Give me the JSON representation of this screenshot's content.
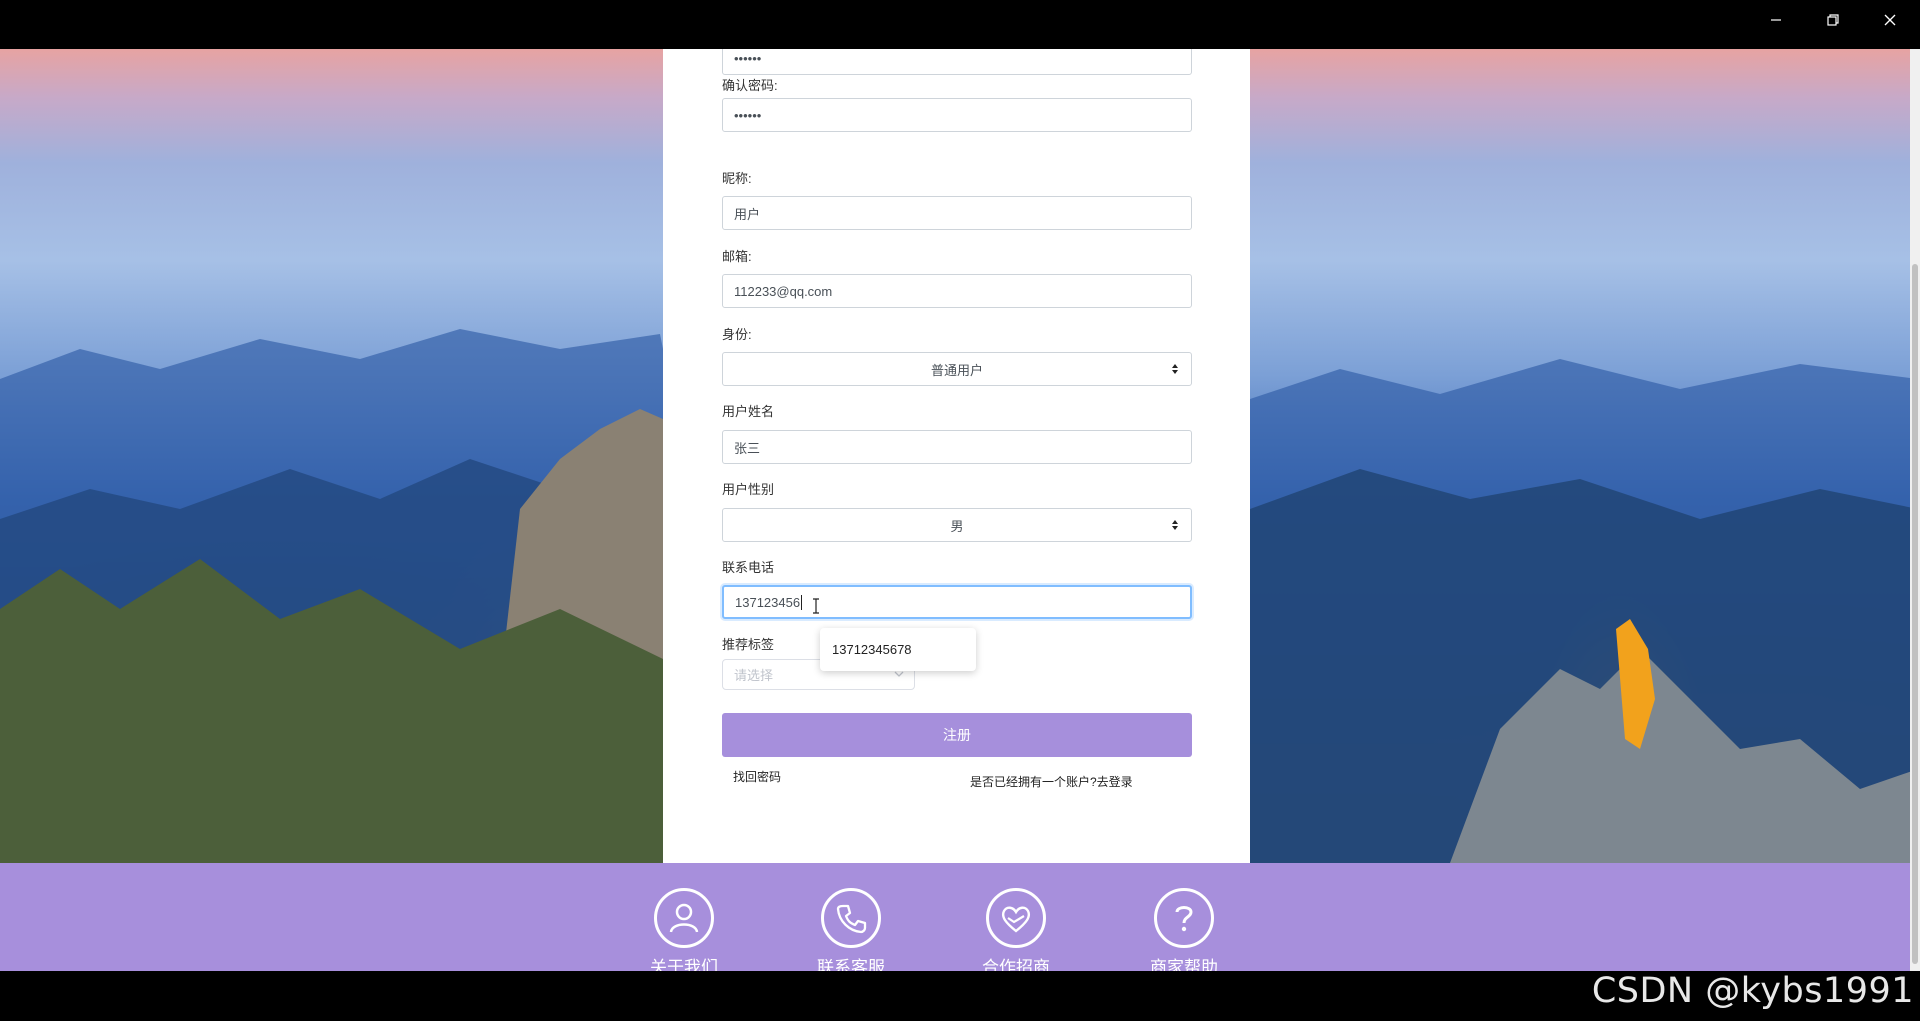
{
  "form": {
    "password_value": "••••••",
    "confirm_password_label": "确认密码:",
    "confirm_password_value": "••••••",
    "nickname_label": "昵称:",
    "nickname_value": "用户",
    "email_label": "邮箱:",
    "email_value": "112233@qq.com",
    "identity_label": "身份:",
    "identity_value": "普通用户",
    "realname_label": "用户姓名",
    "realname_value": "张三",
    "gender_label": "用户性别",
    "gender_value": "男",
    "phone_label": "联系电话",
    "phone_value": "137123456",
    "phone_suggestion": "13712345678",
    "tags_label": "推荐标签",
    "tags_placeholder": "请选择",
    "register_label": "注册",
    "forgot_password": "找回密码",
    "have_account": "是否已经拥有一个账户?去登录"
  },
  "footer": {
    "items": [
      {
        "label": "关于我们",
        "icon": "user-icon"
      },
      {
        "label": "联系客服",
        "icon": "phone-icon"
      },
      {
        "label": "合作招商",
        "icon": "handshake-heart-icon"
      },
      {
        "label": "商家帮助",
        "icon": "question-icon"
      }
    ]
  },
  "watermark": "CSDN @kybs1991",
  "colors": {
    "accent": "#a68fdc",
    "footer": "#a78fdc"
  }
}
